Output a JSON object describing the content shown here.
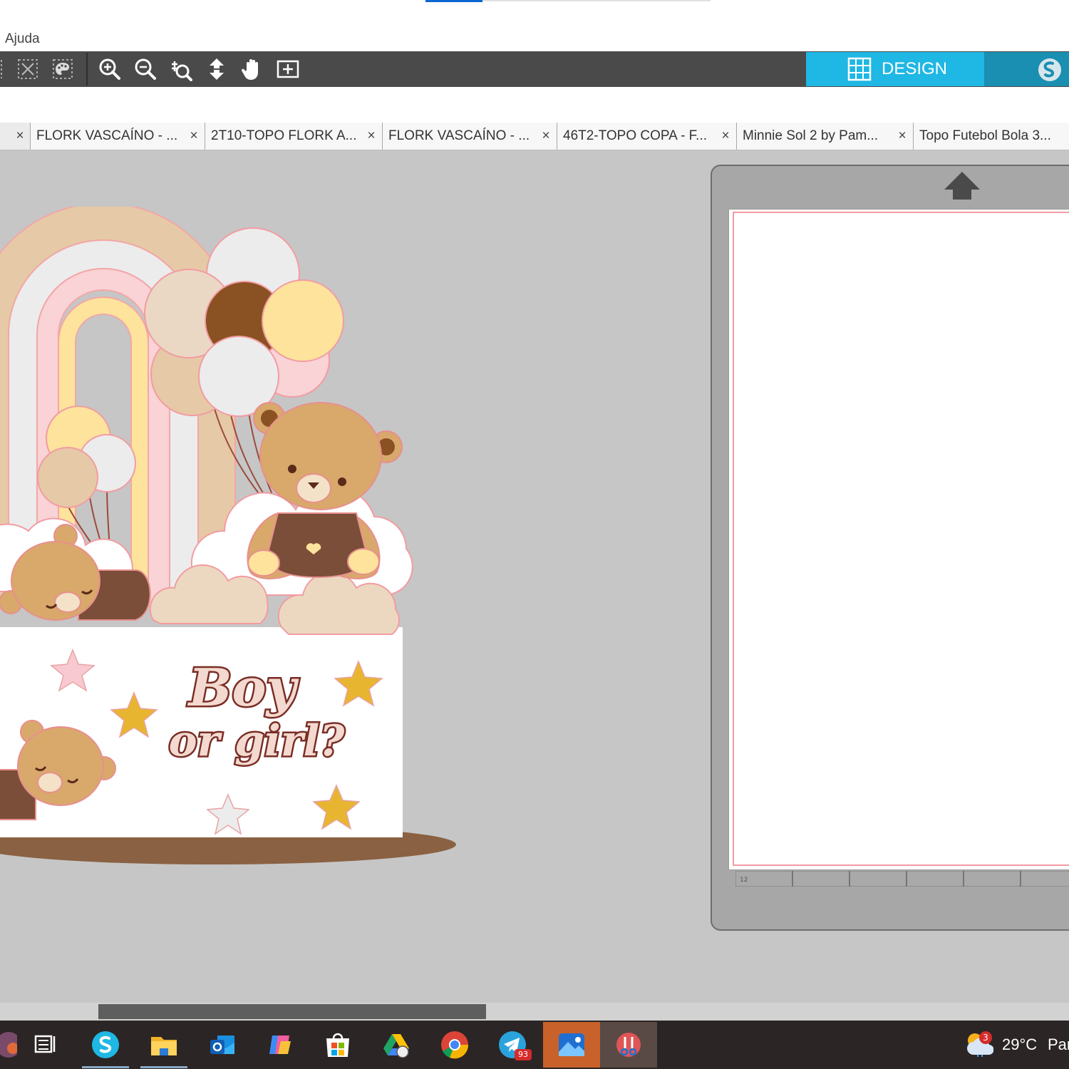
{
  "menu": {
    "help": "Ajuda"
  },
  "toolbar": {
    "tools": [
      "select-all-icon",
      "deselect-icon",
      "zoom-in-icon",
      "zoom-out-icon",
      "zoom-selection-icon",
      "drag-move-icon",
      "pan-hand-icon",
      "fit-to-page-icon"
    ],
    "design_tab": "DESIGN",
    "accent": "#1fb7e3"
  },
  "tabs": [
    {
      "label": "FLORK VASCAÍNO - ..."
    },
    {
      "label": "2T10-TOPO FLORK A..."
    },
    {
      "label": "FLORK VASCAÍNO - ..."
    },
    {
      "label": "46T2-TOPO COPA - F..."
    },
    {
      "label": "Minnie Sol 2 by Pam..."
    },
    {
      "label": "Topo Futebol Bola 3..."
    }
  ],
  "artwork": {
    "title_line1": "Boy",
    "title_line2": "or girl?"
  },
  "mat": {
    "ruler_label": "12"
  },
  "taskbar": {
    "apps": [
      "start-icon",
      "task-view-icon",
      "silhouette-studio-icon",
      "file-explorer-icon",
      "outlook-icon",
      "copilot-icon",
      "microsoft-store-icon",
      "google-drive-icon",
      "chrome-icon",
      "telegram-icon",
      "photos-icon",
      "snipping-tool-icon"
    ],
    "telegram_badge": "93",
    "weather_badge": "3",
    "temperature": "29°C",
    "condition": "Par"
  }
}
